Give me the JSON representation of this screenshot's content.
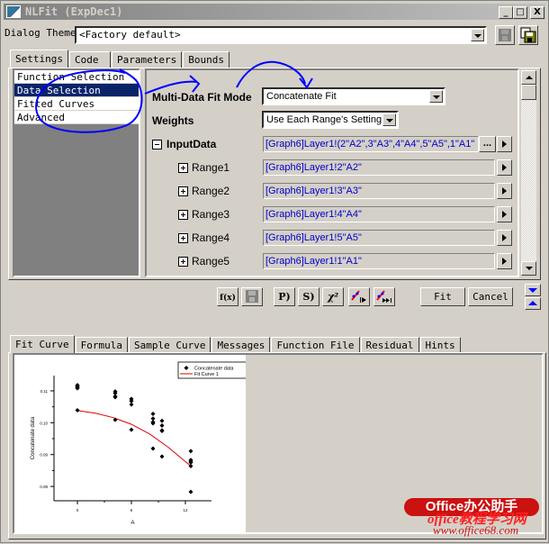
{
  "window": {
    "title": "NLFit (ExpDec1)",
    "controls": {
      "minimize": "_",
      "maximize": "□",
      "close": "X"
    }
  },
  "theme": {
    "label": "Dialog Theme",
    "value": "<Factory default>",
    "save_icon": "floppy-disk-icon",
    "save_as_icon": "floppy-disk-copy-icon"
  },
  "top_tabs": [
    {
      "label": "Settings",
      "active": true
    },
    {
      "label": "Code",
      "active": false
    },
    {
      "label": "Parameters",
      "active": false
    },
    {
      "label": "Bounds",
      "active": false
    }
  ],
  "tree": {
    "items": [
      {
        "label": "Function Selection",
        "selected": false
      },
      {
        "label": "Data Selection",
        "selected": true
      },
      {
        "label": "Fitted Curves",
        "selected": false
      },
      {
        "label": "Advanced",
        "selected": false
      }
    ]
  },
  "settings": {
    "fit_mode": {
      "label": "Multi-Data Fit Mode",
      "value": "Concatenate Fit"
    },
    "weights": {
      "label": "Weights",
      "value": "Use Each Range's Setting"
    },
    "input_data": {
      "label": "InputData",
      "value": "[Graph6]Layer1!(2\"A2\",3\"A3\",4\"A4\",5\"A5\",1\"A1\"",
      "browse_label": "..."
    },
    "ranges": [
      {
        "label": "Range1",
        "value": "[Graph6]Layer1!2\"A2\""
      },
      {
        "label": "Range2",
        "value": "[Graph6]Layer1!3\"A3\""
      },
      {
        "label": "Range3",
        "value": "[Graph6]Layer1!4\"A4\""
      },
      {
        "label": "Range4",
        "value": "[Graph6]Layer1!5\"A5\""
      },
      {
        "label": "Range5",
        "value": "[Graph6]Layer1!1\"A1\""
      }
    ]
  },
  "toolbar": {
    "tools": [
      {
        "name": "function-builder-icon",
        "glyph": "f(x)"
      },
      {
        "name": "save-icon",
        "glyph": ""
      },
      {
        "name": "init-params-icon",
        "glyph": "P)"
      },
      {
        "name": "simplex-icon",
        "glyph": "S)"
      },
      {
        "name": "chi-square-icon",
        "glyph": "χ²"
      },
      {
        "name": "one-iteration-icon",
        "glyph": "▸"
      },
      {
        "name": "fit-until-converged-icon",
        "glyph": "▸▸"
      }
    ],
    "fit_label": "Fit",
    "cancel_label": "Cancel"
  },
  "bottom_tabs": [
    {
      "label": "Fit Curve",
      "active": true
    },
    {
      "label": "Formula",
      "active": false
    },
    {
      "label": "Sample Curve",
      "active": false
    },
    {
      "label": "Messages",
      "active": false
    },
    {
      "label": "Function File",
      "active": false
    },
    {
      "label": "Residual",
      "active": false
    },
    {
      "label": "Hints",
      "active": false
    }
  ],
  "watermark": {
    "line1": "Office办公助手",
    "line2": "office教程学习网",
    "line3": "www.office68.com"
  },
  "colors": {
    "selection": "#0a246a",
    "range_text": "#0000cc",
    "fit_curve": "#dd0000",
    "annotation": "#0000ff"
  },
  "chart_data": {
    "type": "scatter",
    "title": "",
    "xlabel": "A",
    "ylabel": "Concatenate data",
    "xlim": [
      -2.6,
      14.9
    ],
    "ylim": [
      0.0755,
      0.1148
    ],
    "xticks": [
      0,
      6,
      12
    ],
    "xtick_labels": [
      "0",
      "6",
      "12"
    ],
    "yticks": [
      0.08,
      0.09,
      0.1,
      0.11
    ],
    "ytick_labels": [
      "0.08",
      "0.09",
      "0.10",
      "0.11"
    ],
    "grid": false,
    "legend": {
      "position": "top-right",
      "entries": [
        "Concatenate data",
        "Fit Curve 1"
      ]
    },
    "series": [
      {
        "name": "Concatenate data",
        "kind": "scatter",
        "x": [
          0,
          0,
          0,
          0,
          0,
          0,
          4.2,
          4.2,
          4.2,
          4.2,
          4.2,
          6,
          6,
          6,
          6,
          8.4,
          8.4,
          8.4,
          8.4,
          8.4,
          9.4,
          9.4,
          9.4,
          9.4,
          9.4,
          12.6,
          12.6,
          12.6,
          12.6,
          12.6,
          12.6
        ],
        "y": [
          0.1118,
          0.1115,
          0.1112,
          0.111,
          0.1108,
          0.1039,
          0.1098,
          0.1093,
          0.1083,
          0.108,
          0.1009,
          0.1075,
          0.1068,
          0.1057,
          0.0978,
          0.1028,
          0.1013,
          0.1002,
          0.0998,
          0.0919,
          0.1006,
          0.0991,
          0.0976,
          0.0974,
          0.0894,
          0.0911,
          0.0883,
          0.0879,
          0.0875,
          0.0864,
          0.0783
        ]
      },
      {
        "name": "Fit Curve 1",
        "kind": "line",
        "x": [
          0,
          2,
          4,
          6,
          8,
          10,
          12,
          12.6
        ],
        "y": [
          0.1038,
          0.103,
          0.1016,
          0.0995,
          0.0965,
          0.0925,
          0.0878,
          0.0864
        ]
      }
    ]
  }
}
